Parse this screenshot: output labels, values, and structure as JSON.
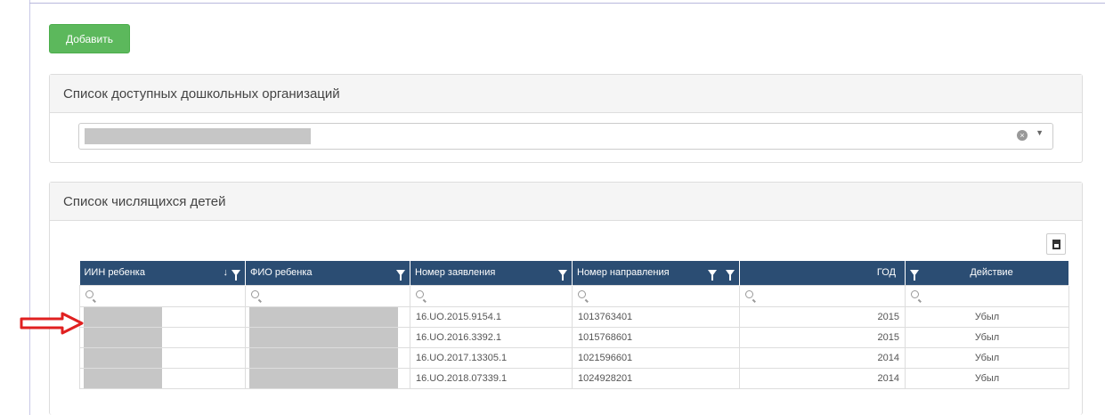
{
  "toolbar": {
    "add_label": "Добавить"
  },
  "orgs_panel": {
    "title": "Список доступных дошкольных организаций",
    "selected_value": ""
  },
  "children_panel": {
    "title": "Список числящихся детей"
  },
  "grid": {
    "columns": [
      {
        "label": "ИИН ребенка"
      },
      {
        "label": "ФИО ребенка"
      },
      {
        "label": "Номер заявления"
      },
      {
        "label": "Номер направления"
      },
      {
        "label": ""
      },
      {
        "label": "ГОД"
      },
      {
        "label": "Действие"
      }
    ],
    "rows": [
      {
        "iin": "",
        "fio": "",
        "app_no": "16.UO.2015.9154.1",
        "dir_no": "1013763401",
        "blank": "",
        "year": "2015",
        "action": "Убыл"
      },
      {
        "iin": "",
        "fio": "",
        "app_no": "16.UO.2016.3392.1",
        "dir_no": "1015768601",
        "blank": "",
        "year": "2015",
        "action": "Убыл"
      },
      {
        "iin": "",
        "fio": "",
        "app_no": "16.UO.2017.13305.1",
        "dir_no": "1021596601",
        "blank": "",
        "year": "2014",
        "action": "Убыл"
      },
      {
        "iin": "",
        "fio": "",
        "app_no": "16.UO.2018.07339.1",
        "dir_no": "1024928201",
        "blank": "",
        "year": "2014",
        "action": "Убыл"
      }
    ]
  },
  "colors": {
    "header_bg": "#2b4d73",
    "add_button": "#5cb85c",
    "link": "#5a7fc5",
    "arrow": "#e02020"
  },
  "icons": {
    "filter": "filter-icon",
    "sort": "sort-down-icon",
    "search": "search-icon",
    "export": "export-excel-icon",
    "clear": "clear-icon",
    "caret": "caret-down-icon",
    "pointer": "red-arrow-icon"
  }
}
